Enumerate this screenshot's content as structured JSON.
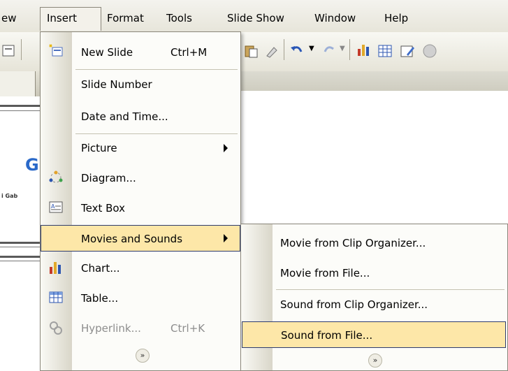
{
  "menubar": {
    "items": [
      {
        "label": "ew"
      },
      {
        "label": "Insert"
      },
      {
        "label": "Format"
      },
      {
        "label": "Tools"
      },
      {
        "label": "Slide Show"
      },
      {
        "label": "Window"
      },
      {
        "label": "Help"
      }
    ]
  },
  "slide_fragment": {
    "logo_letter": "G",
    "small_text": "i Gab"
  },
  "insert_menu": {
    "items": [
      {
        "label": "New Slide",
        "shortcut": "Ctrl+M",
        "icon": "new-slide-icon"
      },
      {
        "label": "Slide Number"
      },
      {
        "label": "Date and Time..."
      },
      {
        "label": "Picture",
        "submenu": true
      },
      {
        "label": "Diagram...",
        "icon": "diagram-icon"
      },
      {
        "label": "Text Box",
        "icon": "text-box-icon"
      },
      {
        "label": "Movies and Sounds",
        "submenu": true,
        "highlighted": true
      },
      {
        "label": "Chart...",
        "icon": "chart-icon"
      },
      {
        "label": "Table...",
        "icon": "table-icon"
      },
      {
        "label": "Hyperlink...",
        "shortcut": "Ctrl+K",
        "disabled": true,
        "icon": "hyperlink-icon"
      }
    ],
    "expand_glyph": "»"
  },
  "movies_submenu": {
    "items": [
      {
        "label": "Movie from Clip Organizer..."
      },
      {
        "label": "Movie from File..."
      },
      {
        "label": "Sound from Clip Organizer..."
      },
      {
        "label": "Sound from File...",
        "highlighted": true
      }
    ],
    "expand_glyph": "»"
  },
  "colors": {
    "highlight": "#fde7a8",
    "highlight_border": "#2e3c6e",
    "menu_bg": "#fcfcf9"
  }
}
